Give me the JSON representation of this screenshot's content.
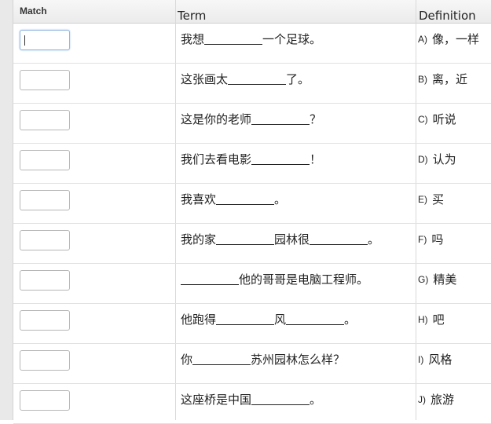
{
  "header": {
    "match": "Match",
    "term": "Term",
    "definition": "Definition"
  },
  "rows": [
    {
      "term": [
        "我想",
        "一个足球。"
      ],
      "def_letter": "A)",
      "def_text": "像，一样",
      "focused": true
    },
    {
      "term": [
        "这张画太",
        "了。"
      ],
      "def_letter": "B)",
      "def_text": "离，近"
    },
    {
      "term": [
        "这是你的老师",
        "？"
      ],
      "def_letter": "C)",
      "def_text": "听说"
    },
    {
      "term": [
        "我们去看电影",
        "！"
      ],
      "def_letter": "D)",
      "def_text": "认为"
    },
    {
      "term": [
        "我喜欢",
        "。"
      ],
      "def_letter": "E)",
      "def_text": "买"
    },
    {
      "term": [
        "我的家",
        "园林很",
        "。"
      ],
      "def_letter": "F)",
      "def_text": "吗"
    },
    {
      "term": [
        "",
        "他的哥哥是电脑工程师。"
      ],
      "def_letter": "G)",
      "def_text": "精美"
    },
    {
      "term": [
        "他跑得",
        "风",
        "。"
      ],
      "def_letter": "H)",
      "def_text": "吧"
    },
    {
      "term": [
        "你",
        "苏州园林怎么样？"
      ],
      "def_letter": "I)",
      "def_text": "风格"
    },
    {
      "term": [
        "这座桥是中国",
        "。"
      ],
      "def_letter": "J)",
      "def_text": "旅游"
    }
  ]
}
